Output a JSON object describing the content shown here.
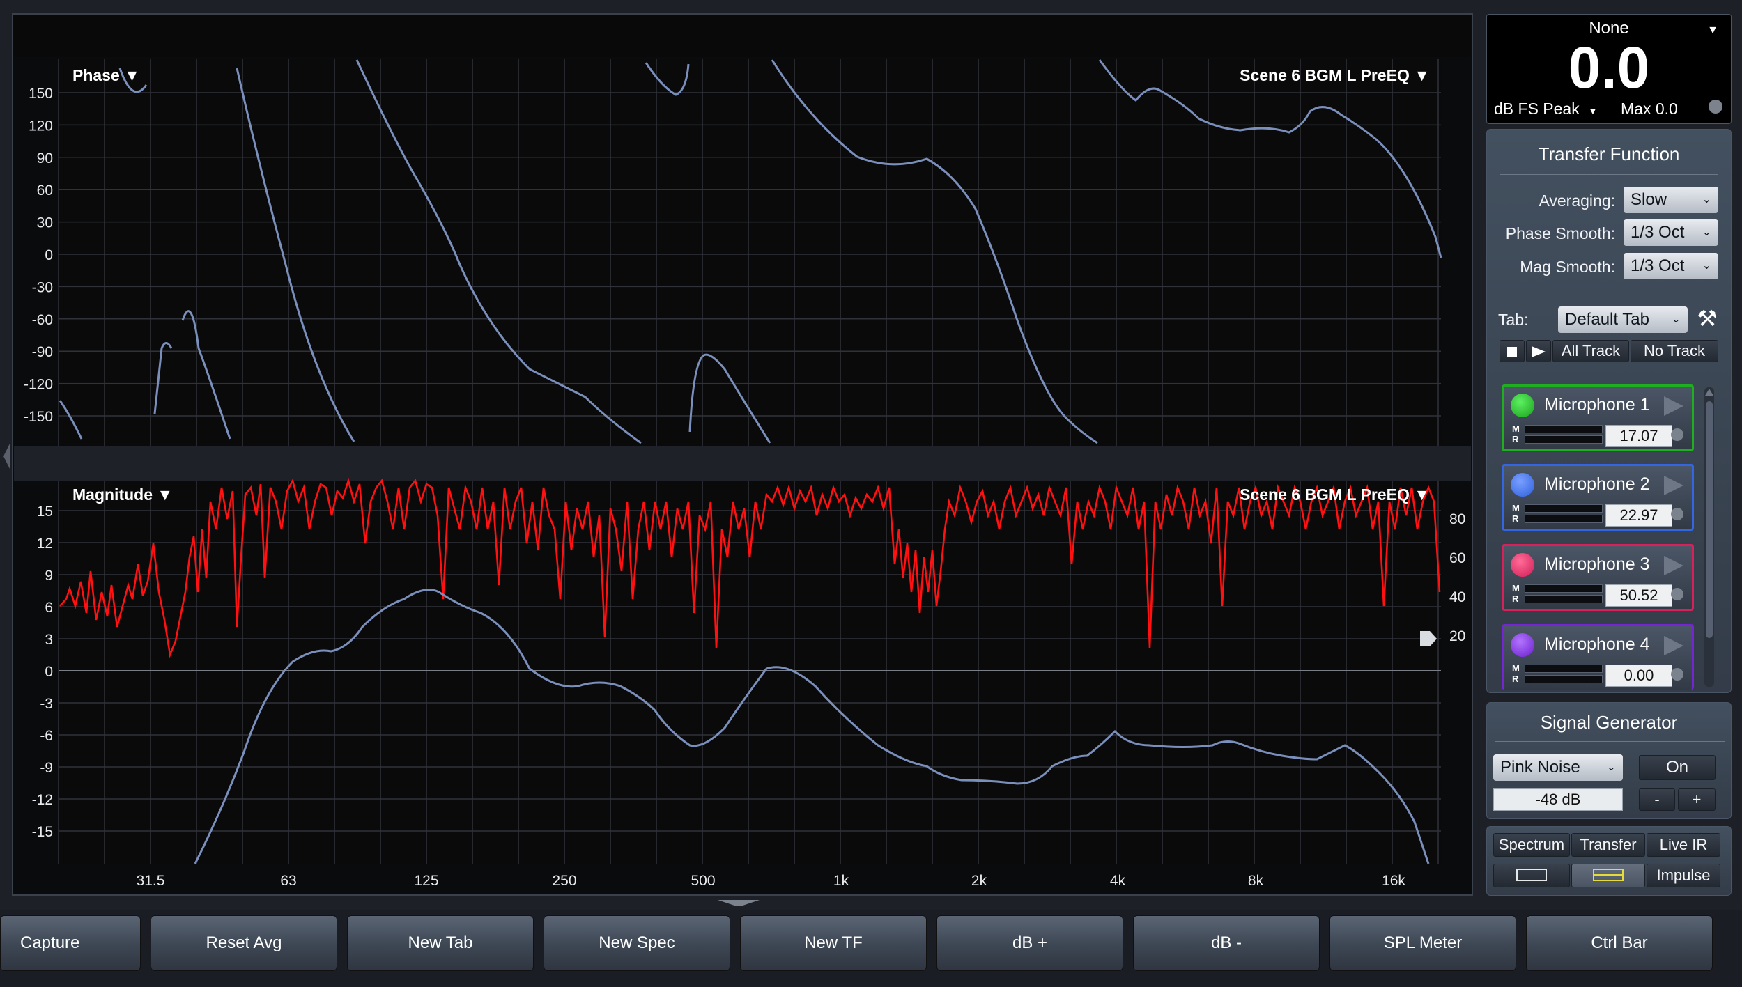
{
  "phase_plot": {
    "title": "Phase ▼",
    "trace_label": "Scene 6 BGM L PreEQ ▼",
    "y_ticks": [
      "150",
      "120",
      "90",
      "60",
      "30",
      "0",
      "-30",
      "-60",
      "-90",
      "-120",
      "-150"
    ],
    "x_ticks": [
      "31.5",
      "63",
      "125",
      "250",
      "500",
      "1k",
      "2k",
      "4k",
      "8k",
      "16k"
    ]
  },
  "magnitude_plot": {
    "title": "Magnitude ▼",
    "trace_label": "Scene 6 BGM L PreEQ ▼",
    "y_ticks": [
      "15",
      "12",
      "9",
      "6",
      "3",
      "0",
      "-3",
      "-6",
      "-9",
      "-12",
      "-15"
    ],
    "right_ticks": [
      "80",
      "60",
      "40",
      "20"
    ],
    "x_ticks": [
      "31.5",
      "63",
      "125",
      "250",
      "500",
      "1k",
      "2k",
      "4k",
      "8k",
      "16k"
    ]
  },
  "meter": {
    "source": "None",
    "value": "0.0",
    "mode": "dB FS Peak",
    "max_label": "Max 0.0"
  },
  "transfer_function": {
    "title": "Transfer Function",
    "averaging_label": "Averaging:",
    "averaging_value": "Slow",
    "phase_smooth_label": "Phase Smooth:",
    "phase_smooth_value": "1/3 Oct",
    "mag_smooth_label": "Mag Smooth:",
    "mag_smooth_value": "1/3 Oct",
    "tab_label": "Tab:",
    "tab_value": "Default Tab",
    "all_track": "All Track",
    "no_track": "No Track",
    "microphones": [
      {
        "name": "Microphone 1",
        "value": "17.07",
        "color": "#22b32a"
      },
      {
        "name": "Microphone 2",
        "value": "22.97",
        "color": "#3f6fe6"
      },
      {
        "name": "Microphone 3",
        "value": "50.52",
        "color": "#e0225f"
      },
      {
        "name": "Microphone 4",
        "value": "0.00",
        "color": "#7d2ad8"
      }
    ],
    "meter_m": "M",
    "meter_r": "R"
  },
  "signal_generator": {
    "title": "Signal Generator",
    "type": "Pink Noise",
    "state": "On",
    "level": "-48 dB",
    "minus": "-",
    "plus": "+"
  },
  "views": {
    "spectrum": "Spectrum",
    "transfer": "Transfer",
    "live_ir": "Live IR",
    "impulse": "Impulse"
  },
  "toolbar": [
    "Capture",
    "Reset Avg",
    "New Tab",
    "New Spec",
    "New TF",
    "dB +",
    "dB -",
    "SPL Meter",
    "Ctrl Bar"
  ],
  "colors": {
    "plot_bg": "#0a0a0a",
    "grid": "#2f3339",
    "phase_trace": "#7b8fbc",
    "coherence_trace": "#ff1111",
    "accent_yellow": "#e5dc3b"
  }
}
